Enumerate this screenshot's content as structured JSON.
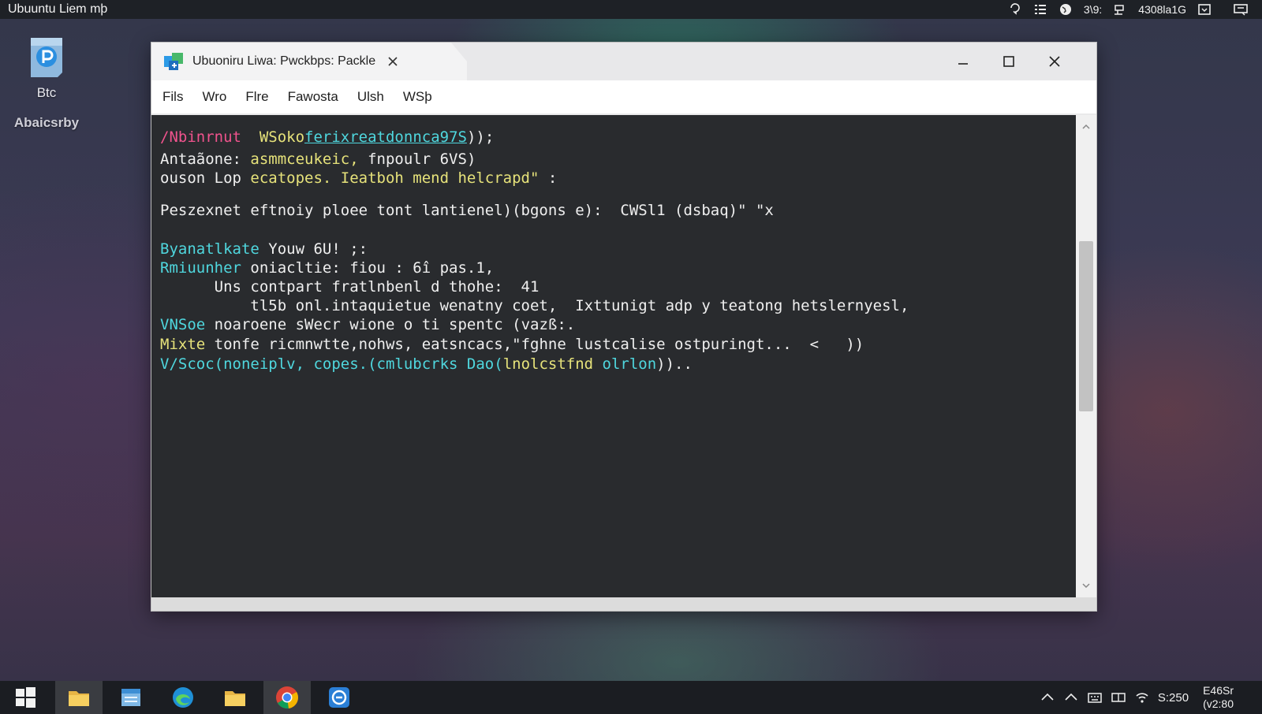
{
  "topbar": {
    "title": "Ubuuntu  Liem mþ",
    "tray": {
      "text1": "3\\9:",
      "text2": "4308la1G"
    }
  },
  "desktop": {
    "icon": {
      "label": "Btc",
      "sublabel": "Abaicsrby"
    }
  },
  "window": {
    "tab_title": "Ubuoniru Liwa: Pwckbps: Packle",
    "menu": [
      "Fils",
      "Wro",
      "Flre",
      "Fawosta",
      "Ulsh",
      "WSþ"
    ],
    "terminal": {
      "l1": {
        "a": "/Nbinrnut",
        "b": "  ",
        "c": "WSoko",
        "d": "ferixreatdonnca97S",
        "e": "));"
      },
      "l2": {
        "a": "Antaãone: ",
        "b": "asmmceukeic,",
        "c": " fnpoulr 6VS)"
      },
      "l3": {
        "a": "ouson Lop ",
        "b": "ecatopes. Ieatboh mend helcrapd\"",
        "c": " :"
      },
      "l4": {
        "a": "Peszexnet eftnoiy ploee tont lantienel)(bgons e):  CWSl1 (dsbaq)\" \"x"
      },
      "l5": {
        "a": "Byanatlkate",
        "b": " Youw 6U! ;:"
      },
      "l6": {
        "a": "Rmiuunher",
        "b": " oniacltie: fiou : 6î pas.1,"
      },
      "l7": {
        "a": "      Uns contpart fratlnbenl d thohe:  41"
      },
      "l8": {
        "a": "          tl5b onl.intaquietue wenatny coet,  Ixttunigt adp y teatong hetslernyesl,"
      },
      "l9": {
        "a": "VNSoe",
        "b": " noaroene sWecr wione o ti spentc (vazß:."
      },
      "l10": {
        "a": "Mixte",
        "b": " tonfe ricmnwtte,nohws, eatsncacs,\"fghne lustcalise ostpuringt...  <   ))"
      },
      "l11": {
        "a": "V/Scoc(noneiplv,",
        "b": " copes.(cmlubcrks Dao(",
        "c": "lnolcstfnd",
        "d": " olrlon",
        "e": "))..",
        "p1": "(",
        "p2": "("
      }
    }
  },
  "taskbar": {
    "tray_text": "S:250",
    "clock_line1": "E46Sr",
    "clock_line2": "(v2:80"
  },
  "colors": {
    "terminal_bg": "#292b2e",
    "pink": "#f0538d",
    "yellow": "#e6e27a",
    "cyan": "#4fd7de",
    "taskbar_bg": "#1b1d22"
  },
  "icons": {
    "topbar": [
      "question-bubble-icon",
      "menu-grid-icon",
      "globe-icon",
      "device-icon",
      "calendar-icon",
      "notification-icon"
    ],
    "taskbar": [
      "windows-start-icon",
      "folder-icon",
      "file-manager-icon",
      "edge-browser-icon",
      "folder-icon",
      "chrome-icon",
      "app-circle-icon"
    ],
    "tray": [
      "chevron-up-icon",
      "chevron-up-icon",
      "keyboard-icon",
      "display-icon",
      "wifi-icon"
    ]
  }
}
